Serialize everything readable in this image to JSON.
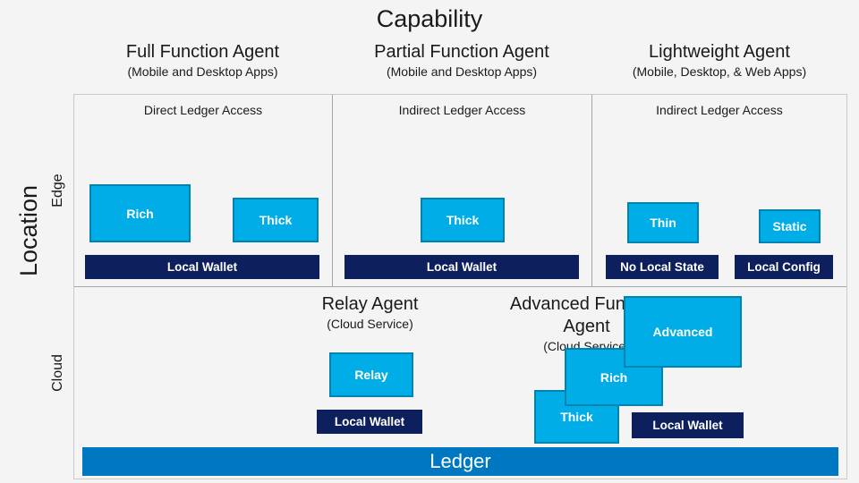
{
  "axes": {
    "x_title": "Capability",
    "y_title": "Location",
    "rows": [
      {
        "label": "Edge"
      },
      {
        "label": "Cloud"
      }
    ]
  },
  "columns": [
    {
      "title": "Full Function Agent",
      "subtitle": "(Mobile and Desktop Apps)",
      "cell_sublabel": "Direct Ledger Access"
    },
    {
      "title": "Partial Function Agent",
      "subtitle": "(Mobile and Desktop Apps)",
      "cell_sublabel": "Indirect Ledger Access"
    },
    {
      "title": "Lightweight Agent",
      "subtitle": "(Mobile, Desktop, & Web Apps)",
      "cell_sublabel": "Indirect Ledger Access"
    }
  ],
  "cloud_headers": [
    {
      "title": "Relay Agent",
      "subtitle": "(Cloud Service)"
    },
    {
      "title": "Advanced Function Agent",
      "subtitle": "(Cloud Service)"
    }
  ],
  "nodes": {
    "edge_full_rich": "Rich",
    "edge_full_thick": "Thick",
    "edge_full_wallet": "Local Wallet",
    "edge_partial_thick": "Thick",
    "edge_partial_wallet": "Local Wallet",
    "edge_light_thin": "Thin",
    "edge_light_static": "Static",
    "edge_light_no_local_state": "No Local State",
    "edge_light_local_config": "Local Config",
    "cloud_relay": "Relay",
    "cloud_relay_wallet": "Local Wallet",
    "cloud_advanced": "Advanced",
    "cloud_rich": "Rich",
    "cloud_thick": "Thick",
    "cloud_advanced_wallet": "Local Wallet",
    "ledger": "Ledger"
  },
  "colors": {
    "agent_fill": "#00ADE6",
    "agent_border": "#0083B0",
    "wallet_fill": "#0D1F5C",
    "ledger_fill": "#0078C1",
    "background": "#f4f4f4",
    "frame_border": "#c9c9c9",
    "divider": "#a6a6a6",
    "text": "#1a1a1a"
  }
}
